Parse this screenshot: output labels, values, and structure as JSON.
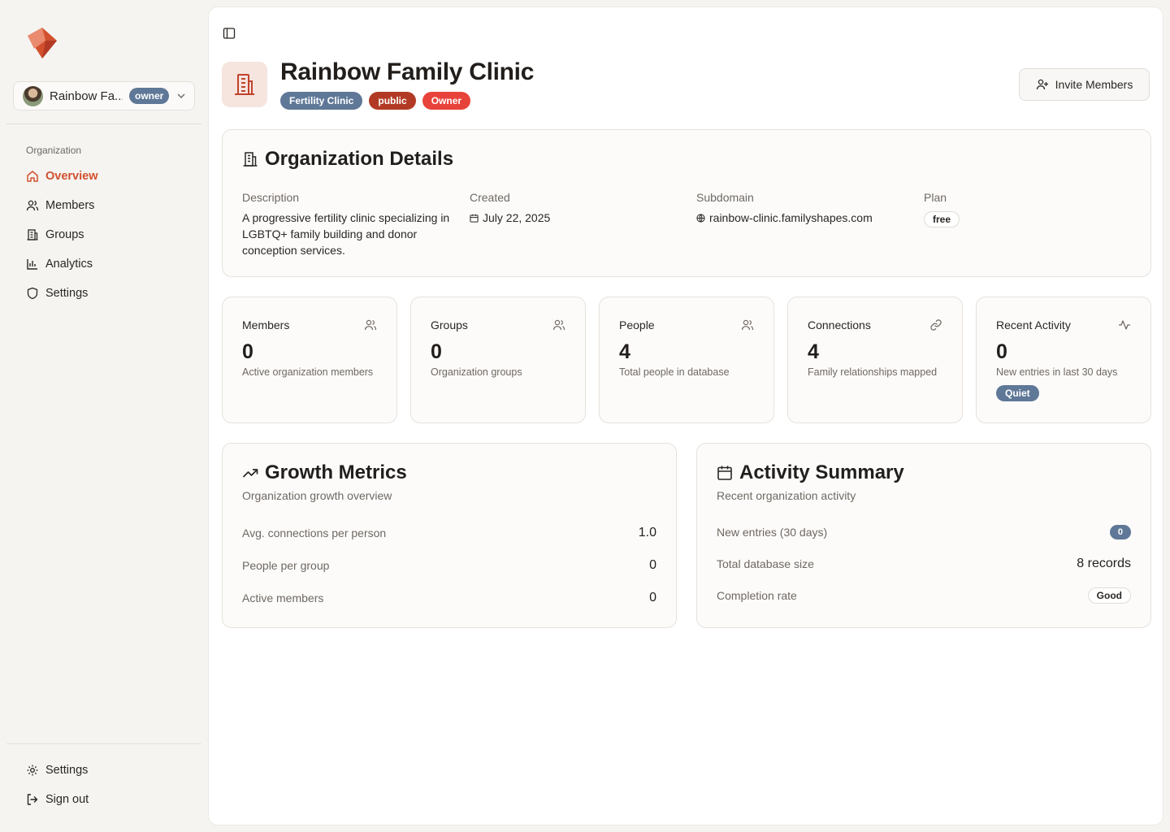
{
  "sidebar": {
    "org_name": "Rainbow Fa...",
    "role_badge": "owner",
    "section_label": "Organization",
    "items": [
      {
        "label": "Overview",
        "icon": "home-icon",
        "active": true
      },
      {
        "label": "Members",
        "icon": "users-icon"
      },
      {
        "label": "Groups",
        "icon": "building-icon"
      },
      {
        "label": "Analytics",
        "icon": "bar-chart-icon"
      },
      {
        "label": "Settings",
        "icon": "shield-icon"
      }
    ],
    "footer": [
      {
        "label": "Settings",
        "icon": "gear-icon"
      },
      {
        "label": "Sign out",
        "icon": "sign-out-icon"
      }
    ]
  },
  "header": {
    "title": "Rainbow Family Clinic",
    "badges": [
      {
        "label": "Fertility Clinic",
        "color": "#5f7897"
      },
      {
        "label": "public",
        "color": "#b23a25"
      },
      {
        "label": "Owner",
        "color": "#e8433a"
      }
    ],
    "invite_label": "Invite Members"
  },
  "details": {
    "title": "Organization Details",
    "description_label": "Description",
    "description": "A progressive fertility clinic specializing in LGBTQ+ family building and donor conception services.",
    "created_label": "Created",
    "created": "July 22, 2025",
    "subdomain_label": "Subdomain",
    "subdomain": "rainbow-clinic.familyshapes.com",
    "plan_label": "Plan",
    "plan": "free"
  },
  "stats": [
    {
      "label": "Members",
      "value": "0",
      "sub": "Active organization members",
      "icon": "users-icon"
    },
    {
      "label": "Groups",
      "value": "0",
      "sub": "Organization groups",
      "icon": "users-icon"
    },
    {
      "label": "People",
      "value": "4",
      "sub": "Total people in database",
      "icon": "users-icon"
    },
    {
      "label": "Connections",
      "value": "4",
      "sub": "Family relationships mapped",
      "icon": "link-icon"
    },
    {
      "label": "Recent Activity",
      "value": "0",
      "sub": "New entries in last 30 days",
      "icon": "activity-icon",
      "badge": "Quiet"
    }
  ],
  "growth": {
    "title": "Growth Metrics",
    "subtitle": "Organization growth overview",
    "rows": [
      {
        "label": "Avg. connections per person",
        "value": "1.0"
      },
      {
        "label": "People per group",
        "value": "0"
      },
      {
        "label": "Active members",
        "value": "0"
      }
    ]
  },
  "activity": {
    "title": "Activity Summary",
    "subtitle": "Recent organization activity",
    "rows": [
      {
        "label": "New entries (30 days)",
        "value": "0"
      },
      {
        "label": "Total database size",
        "value": "8 records"
      },
      {
        "label": "Completion rate",
        "value": "Good"
      }
    ]
  },
  "colors": {
    "accent": "#d2502e",
    "badge_blue": "#5f7897"
  }
}
